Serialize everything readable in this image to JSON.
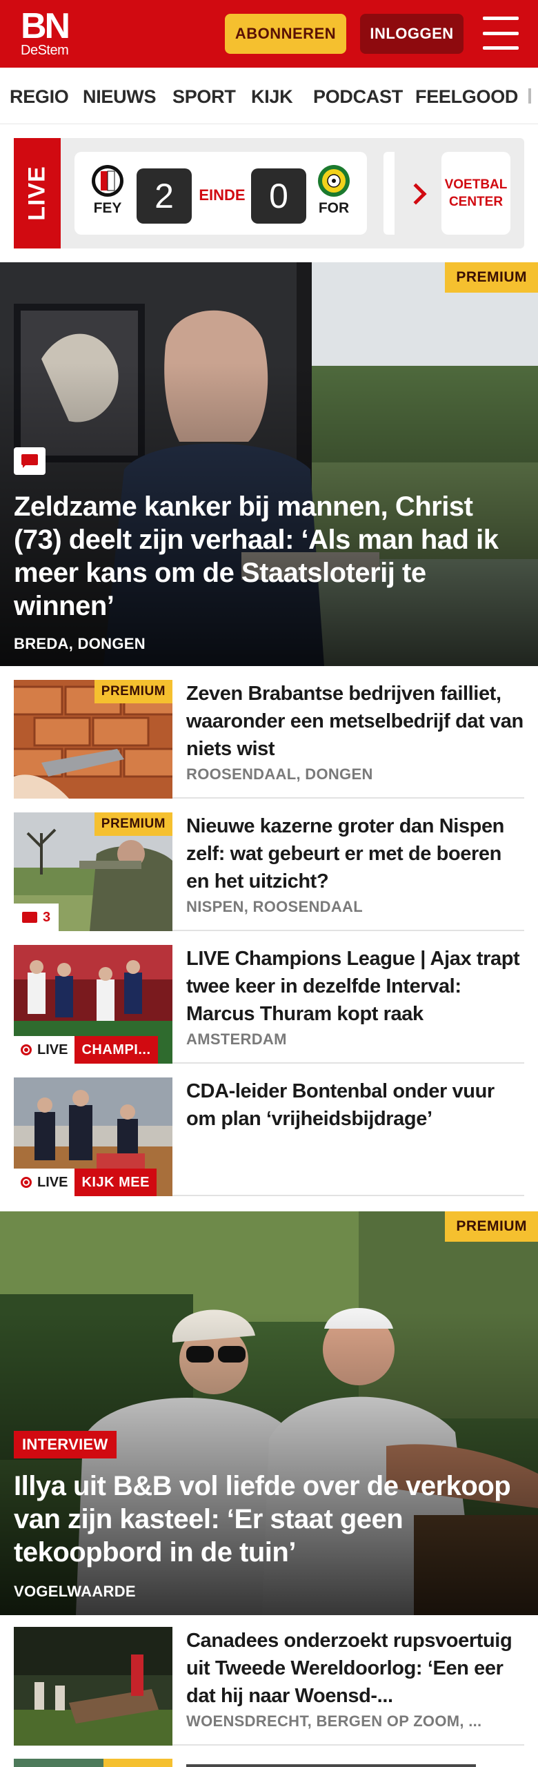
{
  "header": {
    "logo_line1": "BN",
    "logo_line2": "DeStem",
    "subscribe_label": "ABONNEREN",
    "login_label": "INLOGGEN",
    "brand_color": "#d10a11",
    "accent_color": "#f5c02f"
  },
  "nav": {
    "items": [
      "REGIO",
      "NIEUWS",
      "SPORT",
      "KIJK",
      "PODCAST",
      "FEELGOOD"
    ]
  },
  "live_scores": {
    "tag": "LIVE",
    "match": {
      "home": "FEY",
      "home_score": "2",
      "status": "EINDE",
      "away_score": "0",
      "away": "FOR"
    },
    "center_link": "VOETBAL CENTER"
  },
  "hero1": {
    "badge": "PREMIUM",
    "title": "Zeldzame kanker bij mannen, Christ (73) deelt zijn verhaal: ‘Als man had ik meer kans om de Staatsloterij te winnen’",
    "location": "BREDA, DONGEN"
  },
  "articles": [
    {
      "badge": "PREMIUM",
      "title": "Zeven Brabantse bedrijven failliet, waaronder een metselbedrijf dat van niets wist",
      "location": "ROOSENDAAL, DONGEN"
    },
    {
      "badge": "PREMIUM",
      "comments": "3",
      "title": "Nieuwe kazerne groter dan Nispen zelf: wat gebeurt er met de boeren en het uitzicht?",
      "location": "NISPEN, ROOSENDAAL"
    },
    {
      "live_label": "LIVE",
      "live_category": "CHAMPI...",
      "title": "LIVE Champions League | Ajax trapt twee keer in dezelfde Interval: Marcus Thuram kopt raak",
      "location": "AMSTERDAM"
    },
    {
      "live_label": "LIVE",
      "live_category": "KIJK MEE",
      "title": "CDA-leider Bontenbal onder vuur om plan ‘vrijheidsbijdrage’",
      "location": ""
    }
  ],
  "hero2": {
    "badge": "PREMIUM",
    "tag": "INTERVIEW",
    "title": "Illya uit B&B vol liefde over de verkoop van zijn kasteel: ‘Er staat geen tekoopbord in de tuin’",
    "location": "VOGELWAARDE"
  },
  "article_last": {
    "title": "Canadees onderzoekt rupsvoertuig uit Tweede Wereldoorlog: ‘Een eer dat hij naar Woensd-...",
    "location": "WOENSDRECHT, BERGEN OP ZOOM, ..."
  },
  "article_peek": {
    "badge": "PREMIUM"
  }
}
